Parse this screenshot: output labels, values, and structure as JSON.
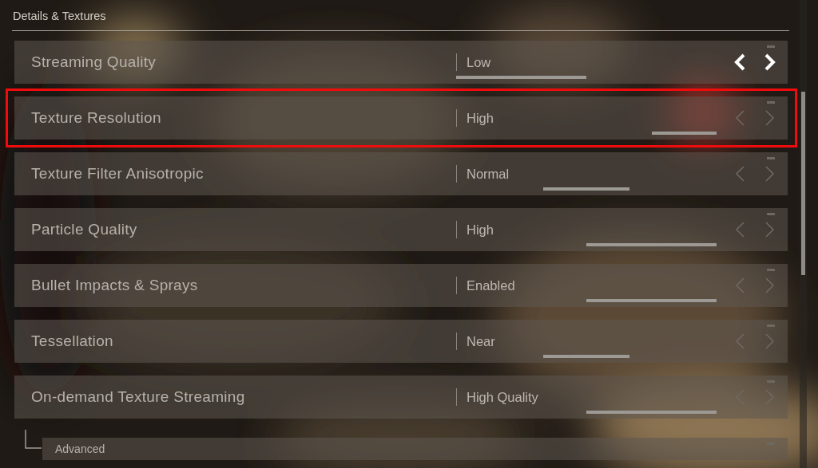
{
  "section": {
    "title": "Details & Textures"
  },
  "settings": [
    {
      "label": "Streaming Quality",
      "value": "Low",
      "focused": true,
      "highlighted": false,
      "indicator": {
        "kind": "first-half"
      }
    },
    {
      "label": "Texture Resolution",
      "value": "High",
      "focused": false,
      "highlighted": true,
      "indicator": {
        "kind": "last-quarter"
      }
    },
    {
      "label": "Texture Filter Anisotropic",
      "value": "Normal",
      "focused": false,
      "highlighted": false,
      "indicator": {
        "kind": "middle-third"
      }
    },
    {
      "label": "Particle Quality",
      "value": "High",
      "focused": false,
      "highlighted": false,
      "indicator": {
        "kind": "second-half"
      }
    },
    {
      "label": "Bullet Impacts & Sprays",
      "value": "Enabled",
      "focused": false,
      "highlighted": false,
      "indicator": {
        "kind": "second-half"
      }
    },
    {
      "label": "Tessellation",
      "value": "Near",
      "focused": false,
      "highlighted": false,
      "indicator": {
        "kind": "middle-third"
      }
    },
    {
      "label": "On-demand Texture Streaming",
      "value": "High Quality",
      "focused": false,
      "highlighted": false,
      "indicator": {
        "kind": "second-half"
      },
      "children": [
        {
          "label": "Advanced"
        }
      ]
    }
  ]
}
